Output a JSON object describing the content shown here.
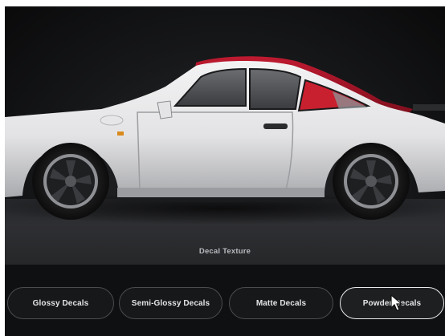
{
  "viewer": {
    "texture_label": "Decal Texture",
    "car_body_color": "#e9e9ea",
    "car_roof_color": "#a11426"
  },
  "decal_options": [
    {
      "label": "Glossy Decals",
      "selected": false
    },
    {
      "label": "Semi-Glossy Decals",
      "selected": false
    },
    {
      "label": "Matte Decals",
      "selected": false
    },
    {
      "label": "Powder Decals",
      "selected": true
    }
  ]
}
